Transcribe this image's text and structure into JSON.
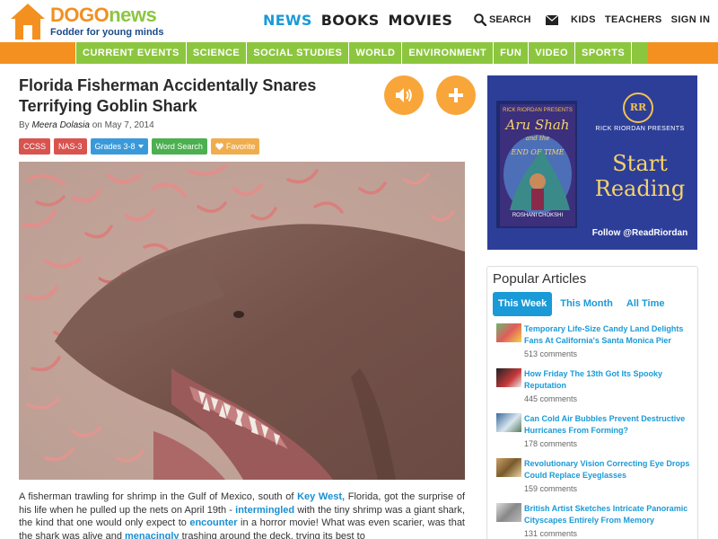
{
  "brand": {
    "logo_dogo": "DOGO",
    "logo_news": "news",
    "tagline": "Fodder for young minds"
  },
  "nav": {
    "main": [
      "NEWS",
      "BOOKS",
      "MOVIES"
    ],
    "search_label": "SEARCH",
    "links": [
      "KIDS",
      "TEACHERS",
      "SIGN IN"
    ]
  },
  "categories": [
    "CURRENT EVENTS",
    "SCIENCE",
    "SOCIAL STUDIES",
    "WORLD",
    "ENVIRONMENT",
    "FUN",
    "VIDEO",
    "SPORTS"
  ],
  "article": {
    "title": "Florida Fisherman Accidentally Snares Terrifying Goblin Shark",
    "by_prefix": "By",
    "author": "Meera Dolasia",
    "date_text": "on May 7, 2014",
    "tags": [
      "CCSS",
      "NAS-3",
      "Grades 3-8",
      "Word Search",
      "Favorite"
    ],
    "body": {
      "p1": "A fisherman trawling for shrimp in the Gulf of Mexico, south of",
      "l1": "Key West,",
      "p2": "Florida, got the surprise of his life when he pulled up the nets on April 19th -",
      "l2": "intermingled",
      "p3": "with the tiny shrimp was a giant shark, the kind that one would only expect to",
      "l3": "encounter",
      "p4": "in a horror movie! What was even scarier, was that the shark was alive and",
      "l4": "menacingly",
      "p5": "trashing around the deck, trying its best to"
    }
  },
  "ad": {
    "publisher_line": "RICK RIORDAN PRESENTS",
    "book_title_1": "Aru Shah",
    "book_title_2": "and the",
    "book_title_3": "END OF TIME",
    "author": "ROSHANI CHOKSHI",
    "cta_1": "Start",
    "cta_2": "Reading",
    "follow": "Follow @ReadRiordan"
  },
  "popular": {
    "title": "Popular Articles",
    "tabs": [
      "This Week",
      "This Month",
      "All Time"
    ],
    "items": [
      {
        "title": "Temporary Life-Size Candy Land Delights Fans At California's Santa Monica Pier",
        "comments": "513 comments"
      },
      {
        "title": "How Friday The 13th Got Its Spooky Reputation",
        "comments": "445 comments"
      },
      {
        "title": "Can Cold Air Bubbles Prevent Destructive Hurricanes From Forming?",
        "comments": "178 comments"
      },
      {
        "title": "Revolutionary Vision Correcting Eye Drops Could Replace Eyeglasses",
        "comments": "159 comments"
      },
      {
        "title": "British Artist Sketches Intricate Panoramic Cityscapes Entirely From Memory",
        "comments": "131 comments"
      }
    ]
  },
  "colors": {
    "orange": "#f39020",
    "green": "#8cc63f",
    "blue": "#1a9ad7",
    "tag_red": "#d9534f",
    "tag_blue": "#3a9ad9",
    "tag_green": "#4caf50",
    "tag_orange": "#f0ad4e"
  }
}
